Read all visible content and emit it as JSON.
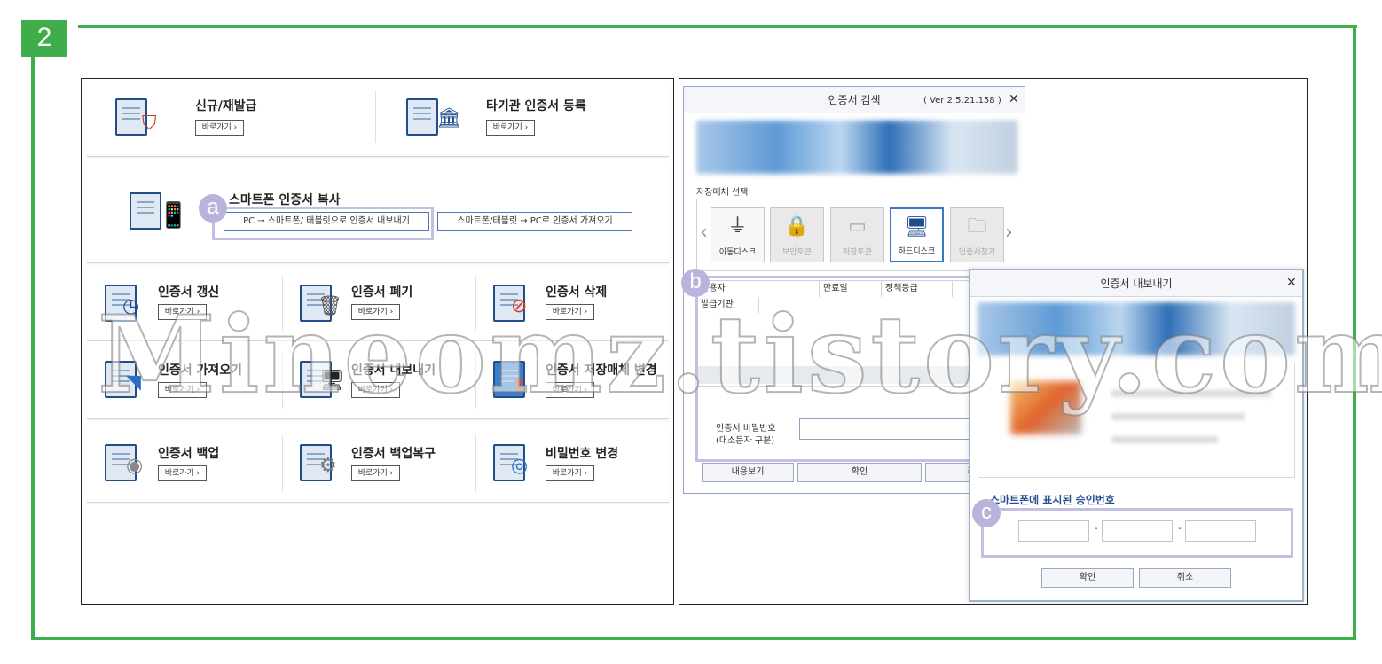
{
  "step_number": "2",
  "left_panel": {
    "row1": [
      {
        "title": "신규/재발급",
        "button": "바로가기 ›"
      },
      {
        "title": "타기관 인증서 등록",
        "button": "바로가기 ›"
      }
    ],
    "smartphone": {
      "title": "스마트폰 인증서 복사",
      "export_button": "PC → 스마트폰/ 태블릿으로 인증서 내보내기",
      "import_button": "스마트폰/태블릿 → PC로 인증서 가져오기"
    },
    "grid": [
      {
        "title": "인증서 갱신",
        "button": "바로가기 ›"
      },
      {
        "title": "인증서 폐기",
        "button": "바로가기 ›"
      },
      {
        "title": "인증서 삭제",
        "button": "바로가기 ›"
      },
      {
        "title": "인증서 가져오기",
        "button": "바로가기 ›"
      },
      {
        "title": "인증서 내보내기",
        "button": "바로가기 ›"
      },
      {
        "title": "인증서 저장매체 변경",
        "button": "바로가기 ›"
      },
      {
        "title": "인증서 백업",
        "button": "바로가기 ›"
      },
      {
        "title": "인증서 백업복구",
        "button": "바로가기 ›"
      },
      {
        "title": "비밀번호 변경",
        "button": "바로가기 ›"
      }
    ]
  },
  "markers": {
    "a": "a",
    "b": "b",
    "c": "c"
  },
  "search_dialog": {
    "title": "인증서 검색",
    "version": "( Ver 2.5.21.158 )",
    "close": "✕",
    "media_section": "저장매체 선택",
    "media": [
      {
        "label": "이동디스크",
        "icon": "usb-icon",
        "glyph": "⏚"
      },
      {
        "label": "보안토큰",
        "icon": "lock-icon",
        "glyph": "🔒"
      },
      {
        "label": "저장토큰",
        "icon": "card-icon",
        "glyph": "▭"
      },
      {
        "label": "하드디스크",
        "icon": "monitor-icon",
        "glyph": "🖥"
      },
      {
        "label": "인증서찾기",
        "icon": "folder-icon",
        "glyph": "🗀"
      }
    ],
    "nav_prev": "‹",
    "nav_next": "›",
    "table_headers": [
      "사용자",
      "만료일",
      "정책등급"
    ],
    "table_header_2": "발급기관",
    "password_label_1": "인증서 비밀번호",
    "password_label_2": "(대소문자 구분)",
    "buttons": [
      "내용보기",
      "확인",
      "취"
    ]
  },
  "approval_dialog": {
    "title": "인증서 내보내기",
    "close": "✕",
    "code_label": "스마트폰에 표시된 승인번호",
    "separator": "-",
    "buttons": [
      "확인",
      "취소"
    ]
  },
  "watermark": "Mineomz.tistory.com"
}
